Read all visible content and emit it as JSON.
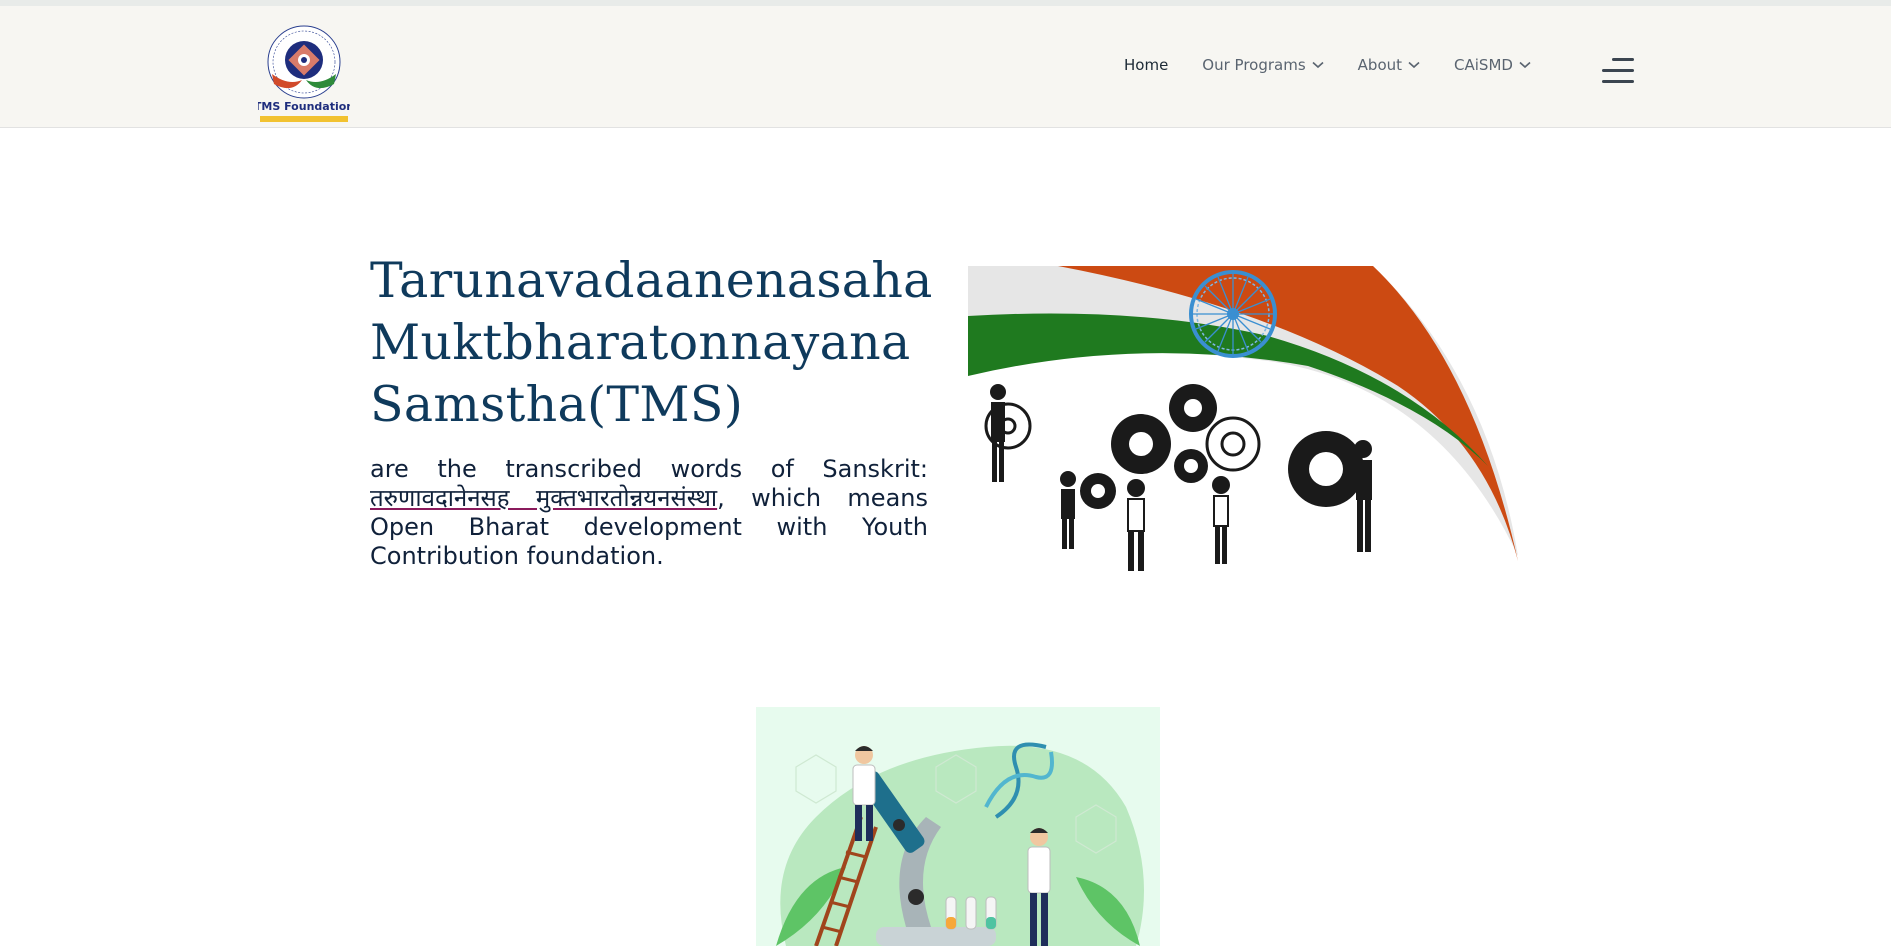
{
  "header": {
    "logo_text": "TMS Foundation",
    "nav": [
      {
        "label": "Home",
        "active": true,
        "has_dropdown": false
      },
      {
        "label": "Our Programs",
        "active": false,
        "has_dropdown": true
      },
      {
        "label": "About",
        "active": false,
        "has_dropdown": true
      },
      {
        "label": "CAiSMD",
        "active": false,
        "has_dropdown": true
      }
    ],
    "menu_icon": "hamburger-icon"
  },
  "hero": {
    "title_line1": "Tarunavadaanenasaha",
    "title_line2": "Muktbharatonnayana",
    "title_line3": "Samstha(TMS)",
    "desc_prefix": "are the transcribed words of Sanskrit: ",
    "desc_devanagari": "तरुणावदानेनसह मुक्तभारतोन्नयनसंस्था",
    "desc_suffix": ", which means Open Bharat development with Youth Contribution foundation."
  },
  "colors": {
    "title": "#0f3a5c",
    "header_bg": "#f7f6f2",
    "saffron": "#cc4a12",
    "green": "#1f7a1f",
    "chakra": "#3a8fd1"
  }
}
